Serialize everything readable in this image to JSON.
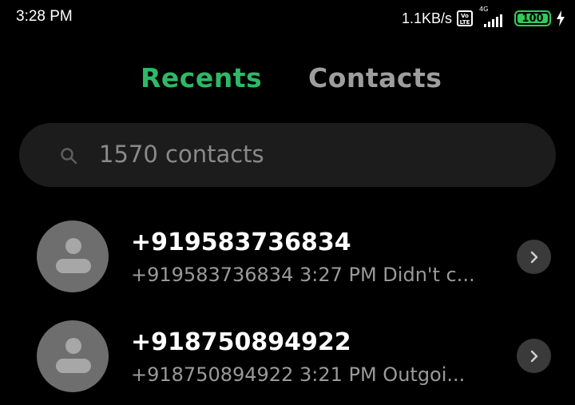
{
  "status_bar": {
    "time": "3:28 PM",
    "net_speed": "1.1KB/s",
    "volte_label": "Vo LTE",
    "network_type": "4G",
    "battery_level": "100",
    "battery_color": "#2ecc5a"
  },
  "tabs": [
    {
      "label": "Recents",
      "active": true,
      "color": "#2fb866"
    },
    {
      "label": "Contacts",
      "active": false,
      "color": "#9e9e9e"
    }
  ],
  "search": {
    "placeholder": "1570 contacts",
    "icon": "search-icon"
  },
  "calls": [
    {
      "name": "+919583736834",
      "detail": "+919583736834 3:27 PM Didn't c...",
      "avatar_icon": "person-icon",
      "action_icon": "chevron-right-icon"
    },
    {
      "name": "+918750894922",
      "detail": "+918750894922 3:21 PM Outgoi...",
      "avatar_icon": "person-icon",
      "action_icon": "chevron-right-icon"
    }
  ]
}
